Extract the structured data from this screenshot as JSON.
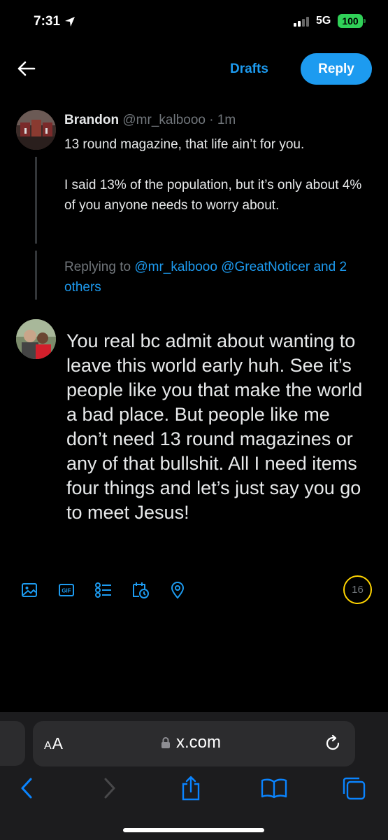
{
  "status_bar": {
    "time": "7:31",
    "network": "5G",
    "battery": "100"
  },
  "header": {
    "drafts_label": "Drafts",
    "reply_label": "Reply"
  },
  "original_tweet": {
    "name": "Brandon",
    "handle": "@mr_kalbooo",
    "separator": "·",
    "age": "1m",
    "line1": "13 round magazine, that life ain’t for you.",
    "line2": "I said 13% of the population, but it’s only about 4% of you anyone needs to worry about."
  },
  "replying_to": {
    "prefix": "Replying to",
    "mention1": "@mr_kalbooo",
    "mention2": "@GreatNoticer",
    "others": "and 2 others"
  },
  "composer": {
    "text": "You real bc admit about wanting to leave this world early huh. See it’s people like you that make the world a bad place. But people like me don’t need 13 round magazines or any of that bullshit. All I need items four things and let’s just say you go to meet Jesus!"
  },
  "toolbar": {
    "gif_label": "GIF",
    "char_counter": "16",
    "accent_color": "#1d9bf0",
    "counter_color": "#ffd400"
  },
  "browser": {
    "text_size_label_small": "A",
    "text_size_label_large": "A",
    "url": "x.com"
  }
}
